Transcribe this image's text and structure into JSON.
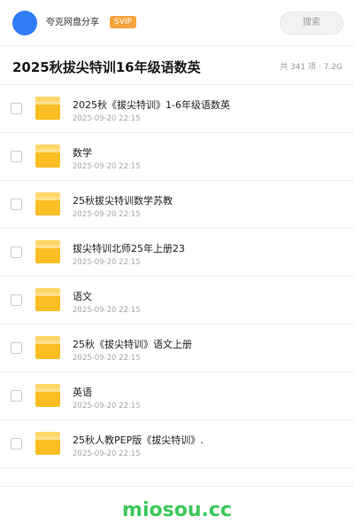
{
  "header": {
    "username": "夸克网盘分享",
    "badge": "SVIP",
    "search_placeholder": "搜索",
    "avatar_color": "#2f7cf6",
    "badge_color": "#f5a33c"
  },
  "folder": {
    "title": "2025秋拔尖特训16年级语数英",
    "meta": "共 341 项 · 7.2G"
  },
  "files": [
    {
      "name": "2025秋《拔尖特训》1-6年级语数英",
      "date": "2025-09-20 22:15",
      "icon": "folder-icon"
    },
    {
      "name": "数学",
      "date": "2025-09-20 22:15",
      "icon": "folder-icon"
    },
    {
      "name": "25秋拔尖特训数学苏教",
      "date": "2025-09-20 22:15",
      "icon": "folder-icon"
    },
    {
      "name": "拔尖特训北师25年上册23",
      "date": "2025-09-20 22:15",
      "icon": "folder-icon"
    },
    {
      "name": "语文",
      "date": "2025-09-20 22:15",
      "icon": "folder-icon"
    },
    {
      "name": "25秋《拔尖特训》语文上册",
      "date": "2025-09-20 22:15",
      "icon": "folder-icon"
    },
    {
      "name": "英语",
      "date": "2025-09-20 22:15",
      "icon": "folder-icon"
    },
    {
      "name": "25秋人教PEP版《拔尖特训》.",
      "date": "2025-09-20 22:15",
      "icon": "folder-icon"
    }
  ],
  "footer": {
    "watermark": "miosou.cc",
    "watermark_color": "#3cc85a"
  },
  "colors": {
    "folder_yellow": "#fbbf24"
  }
}
